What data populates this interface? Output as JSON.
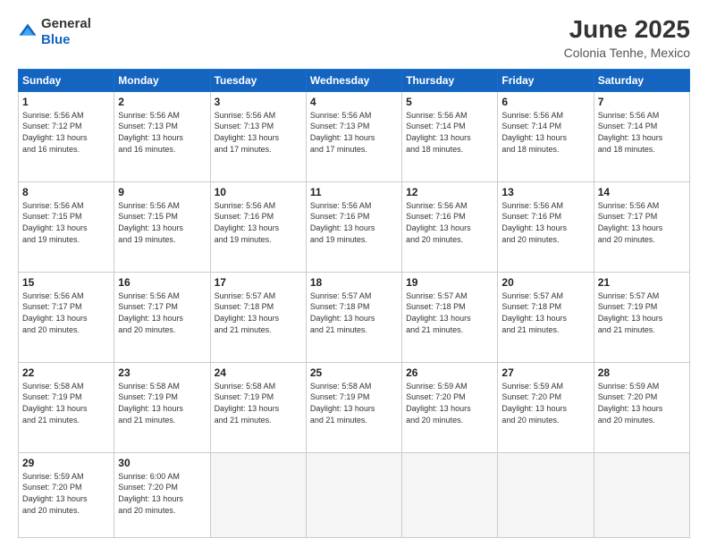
{
  "header": {
    "logo_general": "General",
    "logo_blue": "Blue",
    "title": "June 2025",
    "subtitle": "Colonia Tenhe, Mexico"
  },
  "calendar": {
    "days_of_week": [
      "Sunday",
      "Monday",
      "Tuesday",
      "Wednesday",
      "Thursday",
      "Friday",
      "Saturday"
    ],
    "weeks": [
      [
        {
          "day": "1",
          "info": "Sunrise: 5:56 AM\nSunset: 7:12 PM\nDaylight: 13 hours\nand 16 minutes."
        },
        {
          "day": "2",
          "info": "Sunrise: 5:56 AM\nSunset: 7:13 PM\nDaylight: 13 hours\nand 16 minutes."
        },
        {
          "day": "3",
          "info": "Sunrise: 5:56 AM\nSunset: 7:13 PM\nDaylight: 13 hours\nand 17 minutes."
        },
        {
          "day": "4",
          "info": "Sunrise: 5:56 AM\nSunset: 7:13 PM\nDaylight: 13 hours\nand 17 minutes."
        },
        {
          "day": "5",
          "info": "Sunrise: 5:56 AM\nSunset: 7:14 PM\nDaylight: 13 hours\nand 18 minutes."
        },
        {
          "day": "6",
          "info": "Sunrise: 5:56 AM\nSunset: 7:14 PM\nDaylight: 13 hours\nand 18 minutes."
        },
        {
          "day": "7",
          "info": "Sunrise: 5:56 AM\nSunset: 7:14 PM\nDaylight: 13 hours\nand 18 minutes."
        }
      ],
      [
        {
          "day": "8",
          "info": "Sunrise: 5:56 AM\nSunset: 7:15 PM\nDaylight: 13 hours\nand 19 minutes."
        },
        {
          "day": "9",
          "info": "Sunrise: 5:56 AM\nSunset: 7:15 PM\nDaylight: 13 hours\nand 19 minutes."
        },
        {
          "day": "10",
          "info": "Sunrise: 5:56 AM\nSunset: 7:16 PM\nDaylight: 13 hours\nand 19 minutes."
        },
        {
          "day": "11",
          "info": "Sunrise: 5:56 AM\nSunset: 7:16 PM\nDaylight: 13 hours\nand 19 minutes."
        },
        {
          "day": "12",
          "info": "Sunrise: 5:56 AM\nSunset: 7:16 PM\nDaylight: 13 hours\nand 20 minutes."
        },
        {
          "day": "13",
          "info": "Sunrise: 5:56 AM\nSunset: 7:16 PM\nDaylight: 13 hours\nand 20 minutes."
        },
        {
          "day": "14",
          "info": "Sunrise: 5:56 AM\nSunset: 7:17 PM\nDaylight: 13 hours\nand 20 minutes."
        }
      ],
      [
        {
          "day": "15",
          "info": "Sunrise: 5:56 AM\nSunset: 7:17 PM\nDaylight: 13 hours\nand 20 minutes."
        },
        {
          "day": "16",
          "info": "Sunrise: 5:56 AM\nSunset: 7:17 PM\nDaylight: 13 hours\nand 20 minutes."
        },
        {
          "day": "17",
          "info": "Sunrise: 5:57 AM\nSunset: 7:18 PM\nDaylight: 13 hours\nand 21 minutes."
        },
        {
          "day": "18",
          "info": "Sunrise: 5:57 AM\nSunset: 7:18 PM\nDaylight: 13 hours\nand 21 minutes."
        },
        {
          "day": "19",
          "info": "Sunrise: 5:57 AM\nSunset: 7:18 PM\nDaylight: 13 hours\nand 21 minutes."
        },
        {
          "day": "20",
          "info": "Sunrise: 5:57 AM\nSunset: 7:18 PM\nDaylight: 13 hours\nand 21 minutes."
        },
        {
          "day": "21",
          "info": "Sunrise: 5:57 AM\nSunset: 7:19 PM\nDaylight: 13 hours\nand 21 minutes."
        }
      ],
      [
        {
          "day": "22",
          "info": "Sunrise: 5:58 AM\nSunset: 7:19 PM\nDaylight: 13 hours\nand 21 minutes."
        },
        {
          "day": "23",
          "info": "Sunrise: 5:58 AM\nSunset: 7:19 PM\nDaylight: 13 hours\nand 21 minutes."
        },
        {
          "day": "24",
          "info": "Sunrise: 5:58 AM\nSunset: 7:19 PM\nDaylight: 13 hours\nand 21 minutes."
        },
        {
          "day": "25",
          "info": "Sunrise: 5:58 AM\nSunset: 7:19 PM\nDaylight: 13 hours\nand 21 minutes."
        },
        {
          "day": "26",
          "info": "Sunrise: 5:59 AM\nSunset: 7:20 PM\nDaylight: 13 hours\nand 20 minutes."
        },
        {
          "day": "27",
          "info": "Sunrise: 5:59 AM\nSunset: 7:20 PM\nDaylight: 13 hours\nand 20 minutes."
        },
        {
          "day": "28",
          "info": "Sunrise: 5:59 AM\nSunset: 7:20 PM\nDaylight: 13 hours\nand 20 minutes."
        }
      ],
      [
        {
          "day": "29",
          "info": "Sunrise: 5:59 AM\nSunset: 7:20 PM\nDaylight: 13 hours\nand 20 minutes."
        },
        {
          "day": "30",
          "info": "Sunrise: 6:00 AM\nSunset: 7:20 PM\nDaylight: 13 hours\nand 20 minutes."
        },
        {
          "day": "",
          "info": ""
        },
        {
          "day": "",
          "info": ""
        },
        {
          "day": "",
          "info": ""
        },
        {
          "day": "",
          "info": ""
        },
        {
          "day": "",
          "info": ""
        }
      ]
    ]
  }
}
